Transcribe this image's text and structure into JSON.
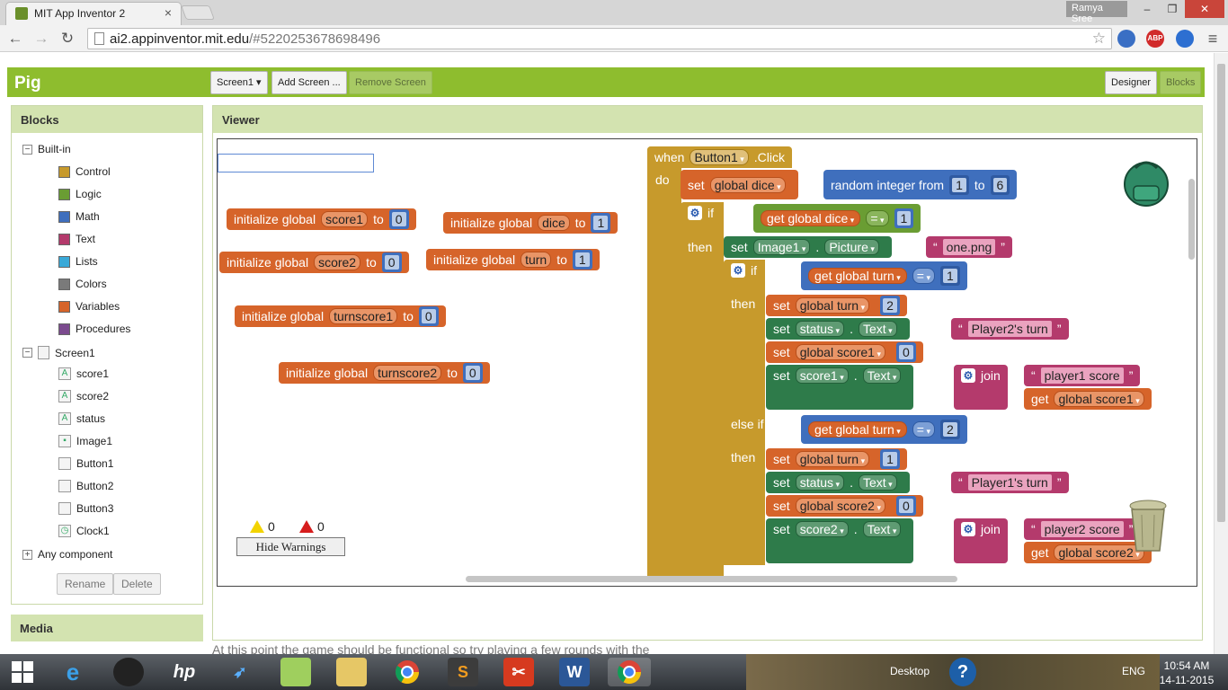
{
  "browser": {
    "tab_title": "MIT App Inventor 2",
    "tab_close": "×",
    "user": "Ramya Sree",
    "url_host": "ai2.appinventor.mit.edu",
    "url_rest": "/#5220253678698496",
    "min_glyph": "–",
    "max_glyph": "❐",
    "close_glyph": "✕",
    "back_glyph": "←",
    "forward_glyph": "→",
    "reload_glyph": "↻",
    "star_glyph": "☆",
    "menu_glyph": "≡",
    "abp_label": "ABP"
  },
  "app": {
    "project_name": "Pig",
    "screen_select": "Screen1 ▾",
    "add_screen": "Add Screen ...",
    "remove_screen": "Remove Screen",
    "designer": "Designer",
    "blocks": "Blocks"
  },
  "blocks_panel": {
    "title": "Blocks",
    "builtin": "Built-in",
    "builtin_items": [
      {
        "label": "Control",
        "color": "#c79a2c"
      },
      {
        "label": "Logic",
        "color": "#6a9d33"
      },
      {
        "label": "Math",
        "color": "#3f6fbd"
      },
      {
        "label": "Text",
        "color": "#b43a6c"
      },
      {
        "label": "Lists",
        "color": "#39a9d8"
      },
      {
        "label": "Colors",
        "color": "#7a7a7a"
      },
      {
        "label": "Variables",
        "color": "#d6642a"
      },
      {
        "label": "Procedures",
        "color": "#7b4a8e"
      }
    ],
    "screen": "Screen1",
    "components": [
      "score1",
      "score2",
      "status",
      "Image1",
      "Button1",
      "Button2",
      "Button3",
      "Clock1"
    ],
    "any_component": "Any component",
    "rename": "Rename",
    "delete": "Delete"
  },
  "viewer": {
    "title": "Viewer",
    "globals": [
      {
        "name": "score1",
        "value": "0"
      },
      {
        "name": "dice",
        "value": "1"
      },
      {
        "name": "score2",
        "value": "0"
      },
      {
        "name": "turn",
        "value": "1"
      },
      {
        "name": "turnscore1",
        "value": "0"
      },
      {
        "name": "turnscore2",
        "value": "0"
      }
    ],
    "init_label": "initialize global",
    "to": "to",
    "warnings_count": "0",
    "errors_count": "0",
    "hide_warnings": "Hide Warnings",
    "event": {
      "when": "when",
      "component": "Button1",
      "event": ".Click",
      "do": "do",
      "set": "set",
      "get": "get",
      "if": "if",
      "then": "then",
      "else_if": "else if",
      "join": "join",
      "text_prop": "Text",
      "picture_prop": "Picture",
      "equals": "=",
      "global_dice": "global dice",
      "global_turn": "global turn",
      "global_score1": "global score1",
      "global_score2": "global score2",
      "random": "random integer from",
      "rand_from": "1",
      "rand_to": "6",
      "dice_cmp": "1",
      "image": "Image1",
      "image_file": "one.png",
      "turn_cmp1": "1",
      "turn_set1": "2",
      "status": "status",
      "status1": "Player2's turn",
      "score1_reset": "0",
      "score1_label": "score1",
      "join1_text": "player1 score",
      "turn_cmp2": "2",
      "turn_set2": "1",
      "status2": "Player1's turn",
      "score2_reset": "0",
      "score2_label": "score2",
      "join2_text": "player2 score"
    }
  },
  "media": {
    "title": "Media"
  },
  "footer_text": "At this point the game should be functional so try playing a few rounds with the computer.",
  "taskbar": {
    "desktop": "Desktop",
    "lang": "ENG",
    "time": "10:54 AM",
    "date": "14-11-2015"
  }
}
